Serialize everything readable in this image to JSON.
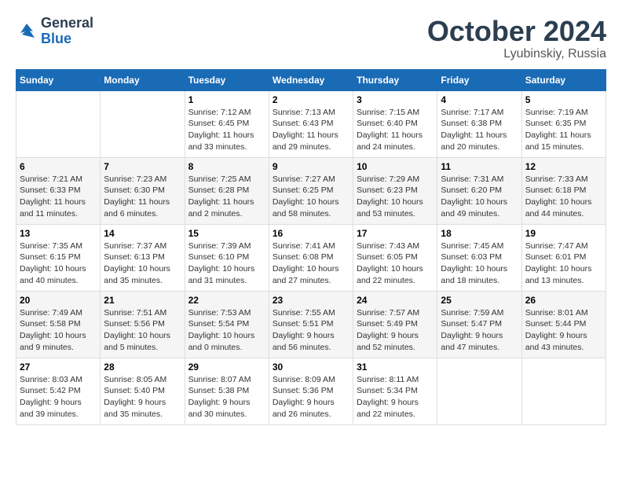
{
  "logo": {
    "line1": "General",
    "line2": "Blue"
  },
  "title": "October 2024",
  "location": "Lyubinskiy, Russia",
  "days_header": [
    "Sunday",
    "Monday",
    "Tuesday",
    "Wednesday",
    "Thursday",
    "Friday",
    "Saturday"
  ],
  "weeks": [
    [
      {
        "day": "",
        "sunrise": "",
        "sunset": "",
        "daylight": ""
      },
      {
        "day": "",
        "sunrise": "",
        "sunset": "",
        "daylight": ""
      },
      {
        "day": "1",
        "sunrise": "Sunrise: 7:12 AM",
        "sunset": "Sunset: 6:45 PM",
        "daylight": "Daylight: 11 hours and 33 minutes."
      },
      {
        "day": "2",
        "sunrise": "Sunrise: 7:13 AM",
        "sunset": "Sunset: 6:43 PM",
        "daylight": "Daylight: 11 hours and 29 minutes."
      },
      {
        "day": "3",
        "sunrise": "Sunrise: 7:15 AM",
        "sunset": "Sunset: 6:40 PM",
        "daylight": "Daylight: 11 hours and 24 minutes."
      },
      {
        "day": "4",
        "sunrise": "Sunrise: 7:17 AM",
        "sunset": "Sunset: 6:38 PM",
        "daylight": "Daylight: 11 hours and 20 minutes."
      },
      {
        "day": "5",
        "sunrise": "Sunrise: 7:19 AM",
        "sunset": "Sunset: 6:35 PM",
        "daylight": "Daylight: 11 hours and 15 minutes."
      }
    ],
    [
      {
        "day": "6",
        "sunrise": "Sunrise: 7:21 AM",
        "sunset": "Sunset: 6:33 PM",
        "daylight": "Daylight: 11 hours and 11 minutes."
      },
      {
        "day": "7",
        "sunrise": "Sunrise: 7:23 AM",
        "sunset": "Sunset: 6:30 PM",
        "daylight": "Daylight: 11 hours and 6 minutes."
      },
      {
        "day": "8",
        "sunrise": "Sunrise: 7:25 AM",
        "sunset": "Sunset: 6:28 PM",
        "daylight": "Daylight: 11 hours and 2 minutes."
      },
      {
        "day": "9",
        "sunrise": "Sunrise: 7:27 AM",
        "sunset": "Sunset: 6:25 PM",
        "daylight": "Daylight: 10 hours and 58 minutes."
      },
      {
        "day": "10",
        "sunrise": "Sunrise: 7:29 AM",
        "sunset": "Sunset: 6:23 PM",
        "daylight": "Daylight: 10 hours and 53 minutes."
      },
      {
        "day": "11",
        "sunrise": "Sunrise: 7:31 AM",
        "sunset": "Sunset: 6:20 PM",
        "daylight": "Daylight: 10 hours and 49 minutes."
      },
      {
        "day": "12",
        "sunrise": "Sunrise: 7:33 AM",
        "sunset": "Sunset: 6:18 PM",
        "daylight": "Daylight: 10 hours and 44 minutes."
      }
    ],
    [
      {
        "day": "13",
        "sunrise": "Sunrise: 7:35 AM",
        "sunset": "Sunset: 6:15 PM",
        "daylight": "Daylight: 10 hours and 40 minutes."
      },
      {
        "day": "14",
        "sunrise": "Sunrise: 7:37 AM",
        "sunset": "Sunset: 6:13 PM",
        "daylight": "Daylight: 10 hours and 35 minutes."
      },
      {
        "day": "15",
        "sunrise": "Sunrise: 7:39 AM",
        "sunset": "Sunset: 6:10 PM",
        "daylight": "Daylight: 10 hours and 31 minutes."
      },
      {
        "day": "16",
        "sunrise": "Sunrise: 7:41 AM",
        "sunset": "Sunset: 6:08 PM",
        "daylight": "Daylight: 10 hours and 27 minutes."
      },
      {
        "day": "17",
        "sunrise": "Sunrise: 7:43 AM",
        "sunset": "Sunset: 6:05 PM",
        "daylight": "Daylight: 10 hours and 22 minutes."
      },
      {
        "day": "18",
        "sunrise": "Sunrise: 7:45 AM",
        "sunset": "Sunset: 6:03 PM",
        "daylight": "Daylight: 10 hours and 18 minutes."
      },
      {
        "day": "19",
        "sunrise": "Sunrise: 7:47 AM",
        "sunset": "Sunset: 6:01 PM",
        "daylight": "Daylight: 10 hours and 13 minutes."
      }
    ],
    [
      {
        "day": "20",
        "sunrise": "Sunrise: 7:49 AM",
        "sunset": "Sunset: 5:58 PM",
        "daylight": "Daylight: 10 hours and 9 minutes."
      },
      {
        "day": "21",
        "sunrise": "Sunrise: 7:51 AM",
        "sunset": "Sunset: 5:56 PM",
        "daylight": "Daylight: 10 hours and 5 minutes."
      },
      {
        "day": "22",
        "sunrise": "Sunrise: 7:53 AM",
        "sunset": "Sunset: 5:54 PM",
        "daylight": "Daylight: 10 hours and 0 minutes."
      },
      {
        "day": "23",
        "sunrise": "Sunrise: 7:55 AM",
        "sunset": "Sunset: 5:51 PM",
        "daylight": "Daylight: 9 hours and 56 minutes."
      },
      {
        "day": "24",
        "sunrise": "Sunrise: 7:57 AM",
        "sunset": "Sunset: 5:49 PM",
        "daylight": "Daylight: 9 hours and 52 minutes."
      },
      {
        "day": "25",
        "sunrise": "Sunrise: 7:59 AM",
        "sunset": "Sunset: 5:47 PM",
        "daylight": "Daylight: 9 hours and 47 minutes."
      },
      {
        "day": "26",
        "sunrise": "Sunrise: 8:01 AM",
        "sunset": "Sunset: 5:44 PM",
        "daylight": "Daylight: 9 hours and 43 minutes."
      }
    ],
    [
      {
        "day": "27",
        "sunrise": "Sunrise: 8:03 AM",
        "sunset": "Sunset: 5:42 PM",
        "daylight": "Daylight: 9 hours and 39 minutes."
      },
      {
        "day": "28",
        "sunrise": "Sunrise: 8:05 AM",
        "sunset": "Sunset: 5:40 PM",
        "daylight": "Daylight: 9 hours and 35 minutes."
      },
      {
        "day": "29",
        "sunrise": "Sunrise: 8:07 AM",
        "sunset": "Sunset: 5:38 PM",
        "daylight": "Daylight: 9 hours and 30 minutes."
      },
      {
        "day": "30",
        "sunrise": "Sunrise: 8:09 AM",
        "sunset": "Sunset: 5:36 PM",
        "daylight": "Daylight: 9 hours and 26 minutes."
      },
      {
        "day": "31",
        "sunrise": "Sunrise: 8:11 AM",
        "sunset": "Sunset: 5:34 PM",
        "daylight": "Daylight: 9 hours and 22 minutes."
      },
      {
        "day": "",
        "sunrise": "",
        "sunset": "",
        "daylight": ""
      },
      {
        "day": "",
        "sunrise": "",
        "sunset": "",
        "daylight": ""
      }
    ]
  ]
}
